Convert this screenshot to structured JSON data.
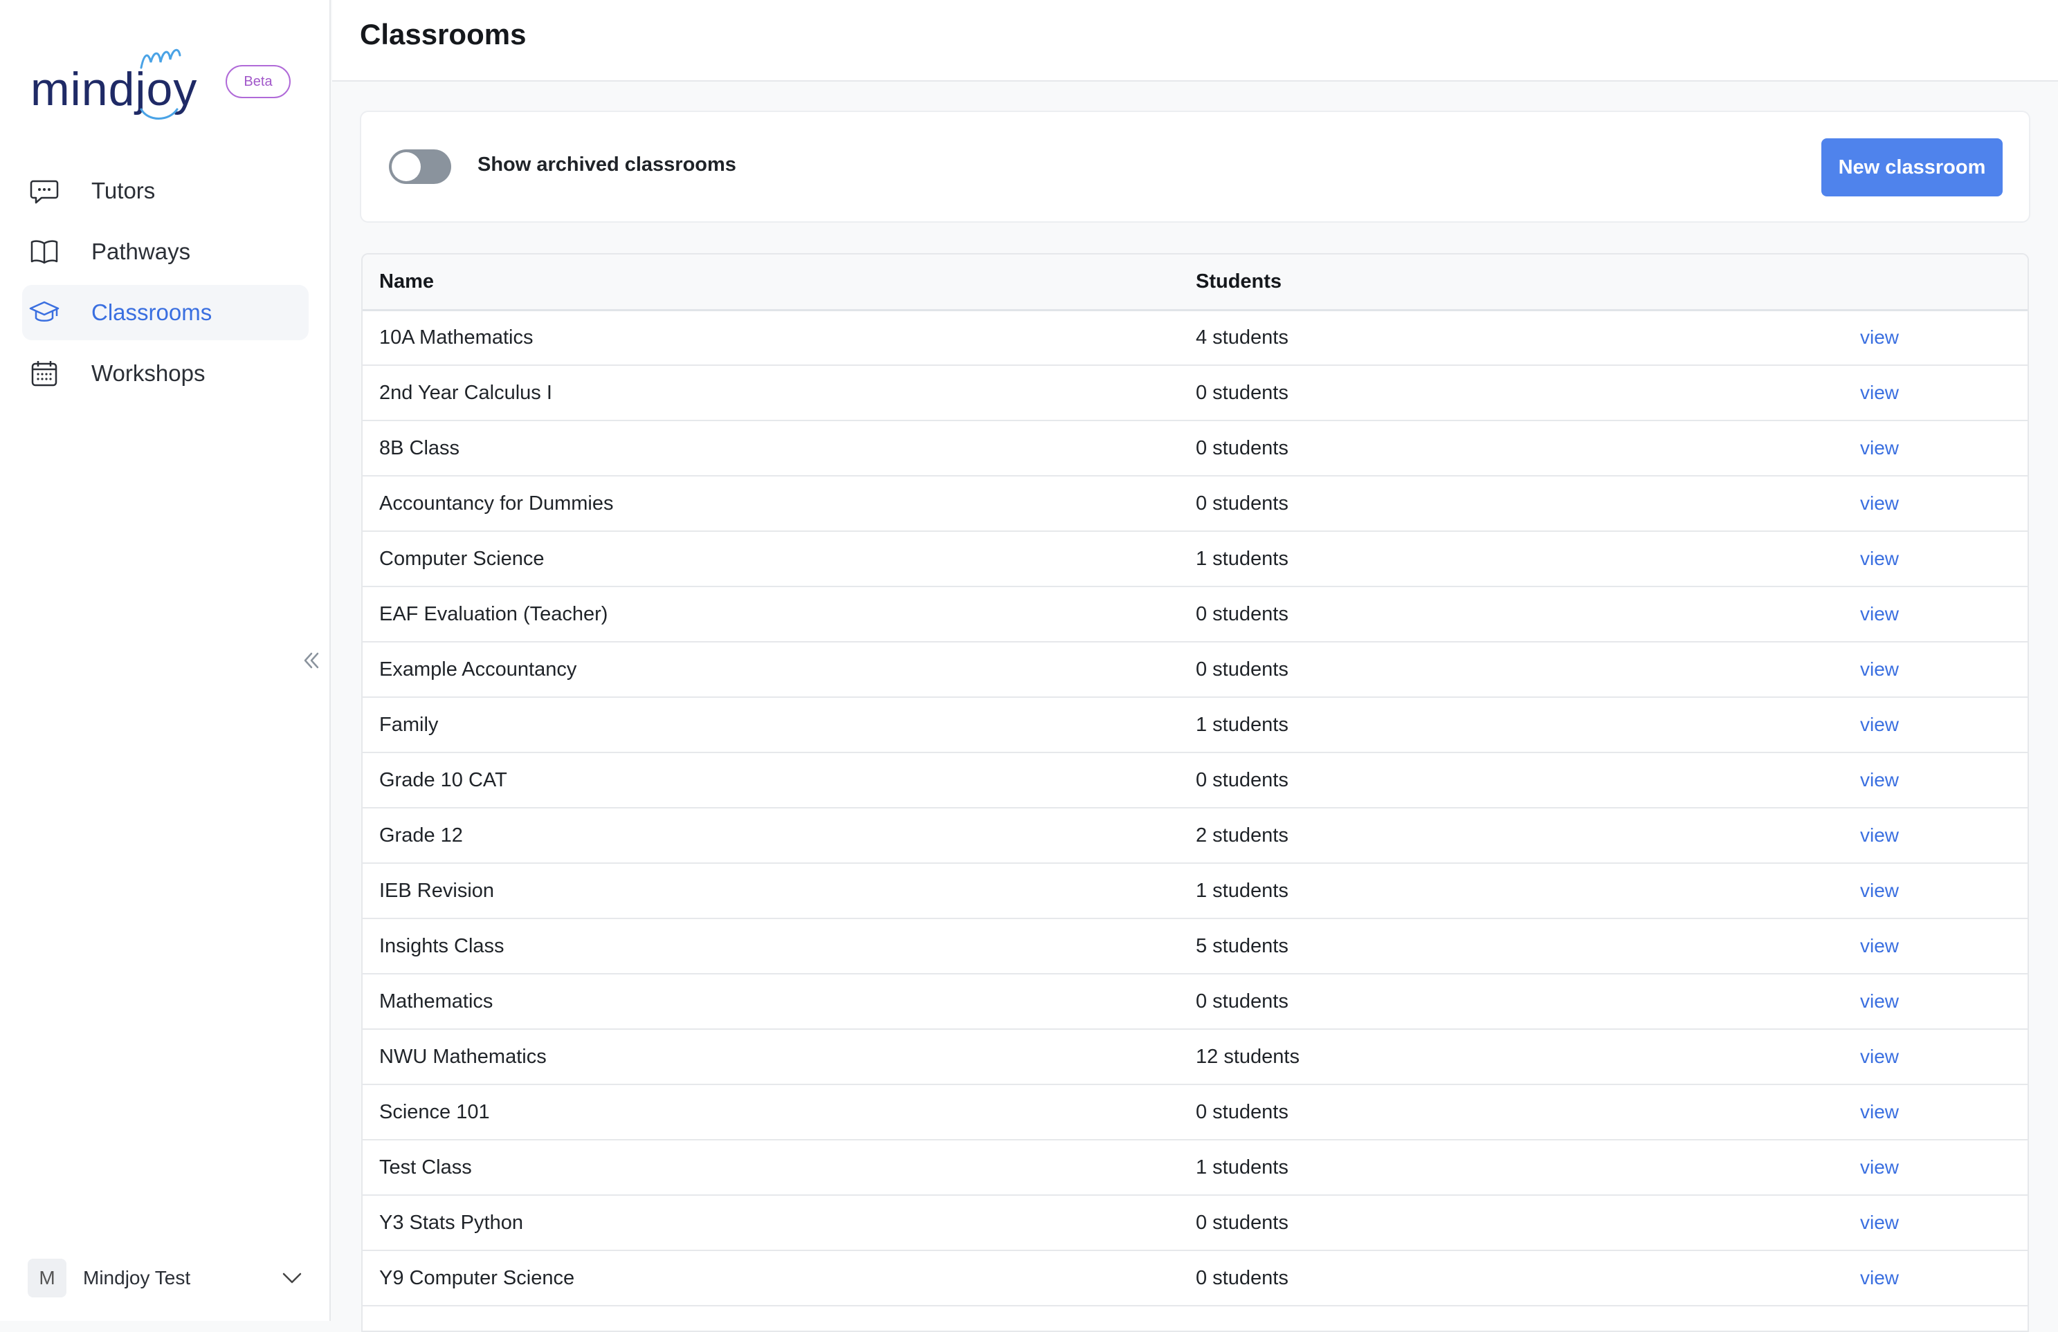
{
  "sidebar": {
    "logo_text": "mindjoy",
    "beta_label": "Beta",
    "nav": [
      {
        "label": "Tutors",
        "icon": "chat-icon",
        "active": false
      },
      {
        "label": "Pathways",
        "icon": "book-icon",
        "active": false
      },
      {
        "label": "Classrooms",
        "icon": "graduation-cap-icon",
        "active": true
      },
      {
        "label": "Workshops",
        "icon": "calendar-icon",
        "active": false
      }
    ],
    "user": {
      "initial": "M",
      "name": "Mindjoy Test"
    }
  },
  "header": {
    "title": "Classrooms"
  },
  "toolbar": {
    "archived_toggle_label": "Show archived classrooms",
    "archived_toggle_on": false,
    "new_button_label": "New classroom"
  },
  "table": {
    "columns": [
      "Name",
      "Students",
      ""
    ],
    "rows": [
      {
        "name": "10A Mathematics",
        "students": "4 students",
        "action": "view"
      },
      {
        "name": "2nd Year Calculus I",
        "students": "0 students",
        "action": "view"
      },
      {
        "name": "8B Class",
        "students": "0 students",
        "action": "view"
      },
      {
        "name": "Accountancy for Dummies",
        "students": "0 students",
        "action": "view"
      },
      {
        "name": "Computer Science",
        "students": "1 students",
        "action": "view"
      },
      {
        "name": "EAF Evaluation (Teacher)",
        "students": "0 students",
        "action": "view"
      },
      {
        "name": "Example Accountancy",
        "students": "0 students",
        "action": "view"
      },
      {
        "name": "Family",
        "students": "1 students",
        "action": "view"
      },
      {
        "name": "Grade 10 CAT",
        "students": "0 students",
        "action": "view"
      },
      {
        "name": "Grade 12",
        "students": "2 students",
        "action": "view"
      },
      {
        "name": "IEB Revision",
        "students": "1 students",
        "action": "view"
      },
      {
        "name": "Insights Class",
        "students": "5 students",
        "action": "view"
      },
      {
        "name": "Mathematics",
        "students": "0 students",
        "action": "view"
      },
      {
        "name": "NWU Mathematics",
        "students": "12 students",
        "action": "view"
      },
      {
        "name": "Science 101",
        "students": "0 students",
        "action": "view"
      },
      {
        "name": "Test Class",
        "students": "1 students",
        "action": "view"
      },
      {
        "name": "Y3 Stats Python",
        "students": "0 students",
        "action": "view"
      },
      {
        "name": "Y9 Computer Science",
        "students": "0 students",
        "action": "view"
      }
    ]
  },
  "colors": {
    "accent": "#3a6fe0",
    "button": "#4f83ec",
    "logo": "#1f2a66",
    "beta": "#a157c9"
  }
}
